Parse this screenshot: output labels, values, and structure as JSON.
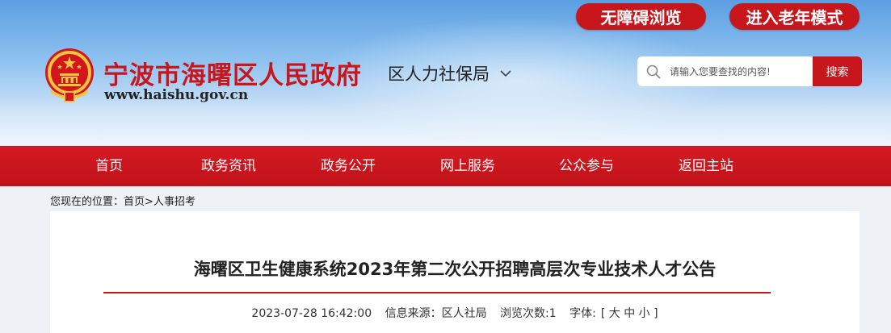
{
  "header": {
    "accessible_button": "无障碍浏览",
    "elder_mode_button": "进入老年模式",
    "site_title": "宁波市海曙区人民政府",
    "site_url": "www.haishu.gov.cn",
    "department": "区人力社保局",
    "search": {
      "placeholder": "请输入您要查找的内容!",
      "button_label": "搜索"
    }
  },
  "nav": {
    "items": [
      {
        "label": "首页"
      },
      {
        "label": "政务资讯"
      },
      {
        "label": "政务公开"
      },
      {
        "label": "网上服务"
      },
      {
        "label": "公众参与"
      },
      {
        "label": "返回主站"
      }
    ]
  },
  "breadcrumb": {
    "prefix": "您现在的位置：",
    "home": "首页",
    "separator": ">",
    "current": "人事招考"
  },
  "article": {
    "title": "海曙区卫生健康系统2023年第二次公开招聘高层次专业技术人才公告",
    "datetime": "2023-07-28 16:42:00",
    "source": "信息来源：区人社局",
    "views": "浏览次数:1",
    "font_label": "字体:",
    "font_sizes": "[ 大 中 小 ]"
  },
  "colors": {
    "brand_red": "#c8161d",
    "sky_blue": "#5b9fe2"
  }
}
